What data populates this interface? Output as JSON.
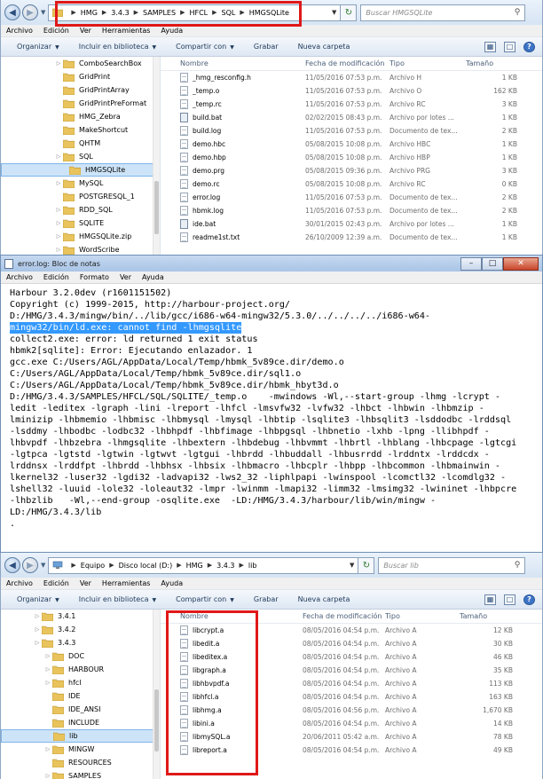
{
  "win1": {
    "breadcrumb": [
      "HMG",
      "3.4.3",
      "SAMPLES",
      "HFCL",
      "SQL",
      "HMGSQLite"
    ],
    "search_placeholder": "Buscar HMGSQLite",
    "menu": [
      "Archivo",
      "Edición",
      "Ver",
      "Herramientas",
      "Ayuda"
    ],
    "toolbar": {
      "organize": "Organizar",
      "include": "Incluir en biblioteca",
      "share": "Compartir con",
      "burn": "Grabar",
      "new_folder": "Nueva carpeta"
    },
    "tree": [
      {
        "label": "ComboSearchBox",
        "expand": true
      },
      {
        "label": "GridPrint",
        "expand": false
      },
      {
        "label": "GridPrintArray",
        "expand": false
      },
      {
        "label": "GridPrintPreFormat",
        "expand": false
      },
      {
        "label": "HMG_Zebra",
        "expand": false
      },
      {
        "label": "MakeShortcut",
        "expand": false
      },
      {
        "label": "QHTM",
        "expand": false
      },
      {
        "label": "SQL",
        "expand": true
      },
      {
        "label": "HMGSQLite",
        "expand": false
      },
      {
        "label": "MySQL",
        "expand": true
      },
      {
        "label": "POSTGRESQL_1",
        "expand": false
      },
      {
        "label": "RDD_SQL",
        "expand": true
      },
      {
        "label": "SQLITE",
        "expand": true
      },
      {
        "label": "HMGSQLite.zip",
        "expand": true
      },
      {
        "label": "WordScribe",
        "expand": true
      }
    ],
    "columns": [
      "Nombre",
      "Fecha de modificación",
      "Tipo",
      "Tamaño"
    ],
    "files": [
      {
        "name": "_hmg_resconfig.h",
        "date": "11/05/2016 07:53 p.m.",
        "type": "Archivo H",
        "size": "1 KB"
      },
      {
        "name": "_temp.o",
        "date": "11/05/2016 07:53 p.m.",
        "type": "Archivo O",
        "size": "162 KB"
      },
      {
        "name": "_temp.rc",
        "date": "11/05/2016 07:53 p.m.",
        "type": "Archivo RC",
        "size": "3 KB"
      },
      {
        "name": "build.bat",
        "date": "02/02/2015 08:43 p.m.",
        "type": "Archivo por lotes ...",
        "size": "1 KB"
      },
      {
        "name": "build.log",
        "date": "11/05/2016 07:53 p.m.",
        "type": "Documento de tex...",
        "size": "2 KB"
      },
      {
        "name": "demo.hbc",
        "date": "05/08/2015 10:08 p.m.",
        "type": "Archivo HBC",
        "size": "1 KB"
      },
      {
        "name": "demo.hbp",
        "date": "05/08/2015 10:08 p.m.",
        "type": "Archivo HBP",
        "size": "1 KB"
      },
      {
        "name": "demo.prg",
        "date": "05/08/2015 09:36 p.m.",
        "type": "Archivo PRG",
        "size": "3 KB"
      },
      {
        "name": "demo.rc",
        "date": "05/08/2015 10:08 p.m.",
        "type": "Archivo RC",
        "size": "0 KB"
      },
      {
        "name": "error.log",
        "date": "11/05/2016 07:53 p.m.",
        "type": "Documento de tex...",
        "size": "2 KB"
      },
      {
        "name": "hbmk.log",
        "date": "11/05/2016 07:53 p.m.",
        "type": "Documento de tex...",
        "size": "2 KB"
      },
      {
        "name": "ide.bat",
        "date": "30/01/2015 02:43 p.m.",
        "type": "Archivo por lotes ...",
        "size": "1 KB"
      },
      {
        "name": "readme1st.txt",
        "date": "26/10/2009 12:39 a.m.",
        "type": "Documento de tex...",
        "size": "1 KB"
      }
    ]
  },
  "notepad": {
    "title": "error.log: Bloc de notas",
    "menu": [
      "Archivo",
      "Edición",
      "Formato",
      "Ver",
      "Ayuda"
    ],
    "lines": [
      "Harbour 3.2.0dev (r1601151502)",
      "Copyright (c) 1999-2015, http://harbour-project.org/",
      "D:/HMG/3.4.3/mingw/bin/../lib/gcc/i686-w64-mingw32/5.3.0/../../../../i686-w64-",
      "mingw32/bin/ld.exe: cannot find -lhmgsqlite",
      "collect2.exe: error: ld returned 1 exit status",
      "hbmk2[sqlite]: Error: Ejecutando enlazador. 1",
      "gcc.exe C:/Users/AGL/AppData/Local/Temp/hbmk_5v89ce.dir/demo.o",
      "C:/Users/AGL/AppData/Local/Temp/hbmk_5v89ce.dir/sql1.o",
      "C:/Users/AGL/AppData/Local/Temp/hbmk_5v89ce.dir/hbmk_hbyt3d.o",
      "D:/HMG/3.4.3/SAMPLES/HFCL/SQL/SQLITE/_temp.o    -mwindows -Wl,--start-group -lhmg -lcrypt -",
      "ledit -leditex -lgraph -lini -lreport -lhfcl -lmsvfw32 -lvfw32 -lhbct -lhbwin -lhbmzip -",
      "lminizip -lhbmemio -lhbmisc -lhbmysql -lmysql -lhbtip -lsqlite3 -lhbsqlit3 -lsddodbc -lrddsql",
      "-lsddmy -lhbodbc -lodbc32 -lhbhpdf -lhbfimage -lhbpgsql -lhbnetio -lxhb -lpng -llibhpdf -",
      "lhbvpdf -lhbzebra -lhmgsqlite -lhbextern -lhbdebug -lhbvmmt -lhbrtl -lhblang -lhbcpage -lgtcgi",
      "-lgtpca -lgtstd -lgtwin -lgtwvt -lgtgui -lhbrdd -lhbuddall -lhbusrrdd -lrddntx -lrddcdx -",
      "lrddnsx -lrddfpt -lhbrdd -lhbhsx -lhbsix -lhbmacro -lhbcplr -lhbpp -lhbcommon -lhbmainwin -",
      "lkernel32 -luser32 -lgdi32 -ladvapi32 -lws2_32 -liphlpapi -lwinspool -lcomctl32 -lcomdlg32 -",
      "lshell32 -luuid -lole32 -loleaut32 -lmpr -lwinmm -lmapi32 -limm32 -lmsimg32 -lwininet -lhbpcre",
      "-lhbzlib   -Wl,--end-group -osqlite.exe  -LD:/HMG/3.4.3/harbour/lib/win/mingw -",
      "LD:/HMG/3.4.3/lib",
      "."
    ]
  },
  "win3": {
    "breadcrumb": [
      "Equipo",
      "Disco local (D:)",
      "HMG",
      "3.4.3",
      "lib"
    ],
    "search_placeholder": "Buscar lib",
    "menu": [
      "Archivo",
      "Edición",
      "Ver",
      "Herramientas",
      "Ayuda"
    ],
    "toolbar": {
      "organize": "Organizar",
      "include": "Incluir en biblioteca",
      "share": "Compartir con",
      "burn": "Grabar",
      "new_folder": "Nueva carpeta"
    },
    "tree": [
      {
        "label": "3.4.1",
        "expand": true,
        "indent": 0
      },
      {
        "label": "3.4.2",
        "expand": true,
        "indent": 0
      },
      {
        "label": "3.4.3",
        "expand": true,
        "indent": 0
      },
      {
        "label": "DOC",
        "expand": true,
        "indent": 1
      },
      {
        "label": "HARBOUR",
        "expand": true,
        "indent": 1
      },
      {
        "label": "hfcl",
        "expand": true,
        "indent": 1
      },
      {
        "label": "IDE",
        "expand": false,
        "indent": 1
      },
      {
        "label": "IDE_ANSI",
        "expand": false,
        "indent": 1
      },
      {
        "label": "INCLUDE",
        "expand": false,
        "indent": 1
      },
      {
        "label": "lib",
        "expand": false,
        "indent": 1
      },
      {
        "label": "MINGW",
        "expand": true,
        "indent": 1
      },
      {
        "label": "RESOURCES",
        "expand": false,
        "indent": 1
      },
      {
        "label": "SAMPLES",
        "expand": true,
        "indent": 1
      }
    ],
    "columns": [
      "Nombre",
      "Fecha de modificación",
      "Tipo",
      "Tamaño"
    ],
    "files": [
      {
        "name": "libcrypt.a",
        "date": "08/05/2016 04:54 p.m.",
        "type": "Archivo A",
        "size": "12 KB"
      },
      {
        "name": "libedit.a",
        "date": "08/05/2016 04:54 p.m.",
        "type": "Archivo A",
        "size": "30 KB"
      },
      {
        "name": "libeditex.a",
        "date": "08/05/2016 04:54 p.m.",
        "type": "Archivo A",
        "size": "46 KB"
      },
      {
        "name": "libgraph.a",
        "date": "08/05/2016 04:54 p.m.",
        "type": "Archivo A",
        "size": "35 KB"
      },
      {
        "name": "libhbvpdf.a",
        "date": "08/05/2016 04:54 p.m.",
        "type": "Archivo A",
        "size": "113 KB"
      },
      {
        "name": "libhfcl.a",
        "date": "08/05/2016 04:54 p.m.",
        "type": "Archivo A",
        "size": "163 KB"
      },
      {
        "name": "libhmg.a",
        "date": "08/05/2016 04:56 p.m.",
        "type": "Archivo A",
        "size": "1,670 KB"
      },
      {
        "name": "libini.a",
        "date": "08/05/2016 04:54 p.m.",
        "type": "Archivo A",
        "size": "14 KB"
      },
      {
        "name": "libmySQL.a",
        "date": "20/06/2011 05:42 a.m.",
        "type": "Archivo A",
        "size": "78 KB"
      },
      {
        "name": "libreport.a",
        "date": "08/05/2016 04:54 p.m.",
        "type": "Archivo A",
        "size": "49 KB"
      }
    ]
  }
}
